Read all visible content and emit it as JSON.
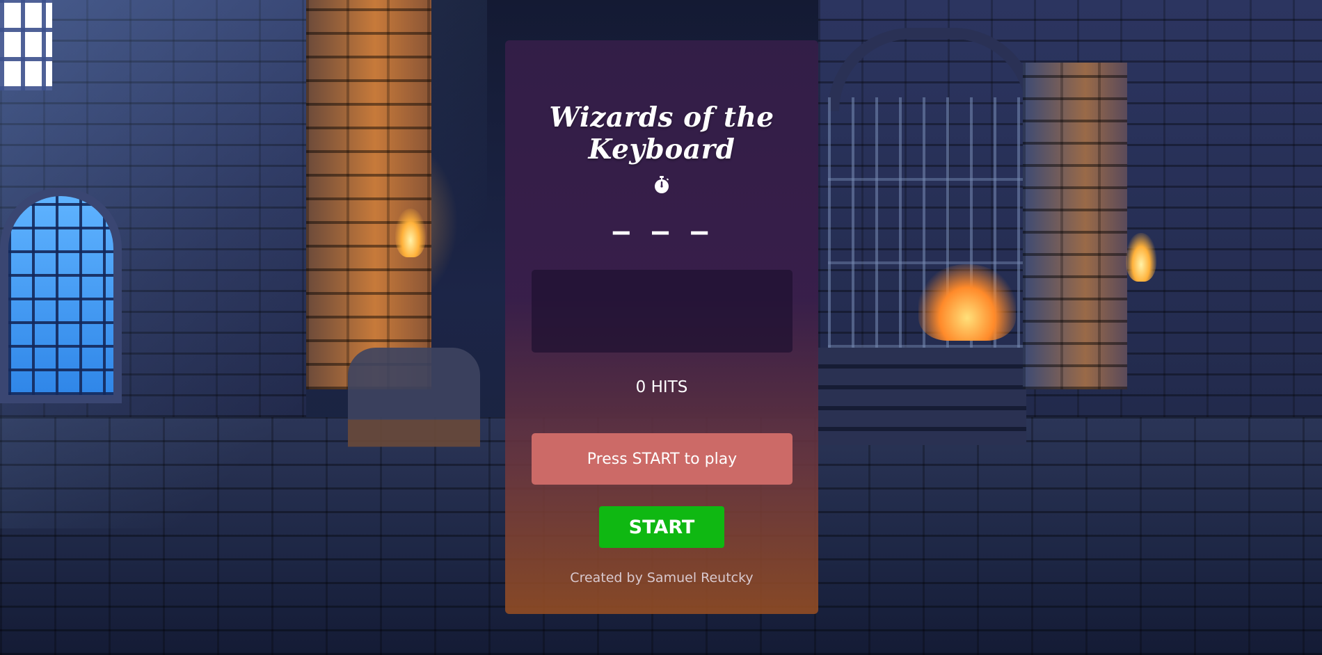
{
  "app": {
    "title": "Wizards of the Keyboard"
  },
  "timer": {
    "icon": "stopwatch-icon",
    "value": "– – –"
  },
  "word_display": {
    "text": ""
  },
  "score": {
    "hits_label": "0 HITS"
  },
  "message": {
    "text": "Press START to play"
  },
  "controls": {
    "start_label": "START"
  },
  "footer": {
    "credit": "Created by Samuel Reutcky"
  },
  "colors": {
    "message_bg": "#cc6a67",
    "start_button": "#0fb812",
    "panel_top": "#341e48",
    "panel_bottom": "#964e23"
  }
}
